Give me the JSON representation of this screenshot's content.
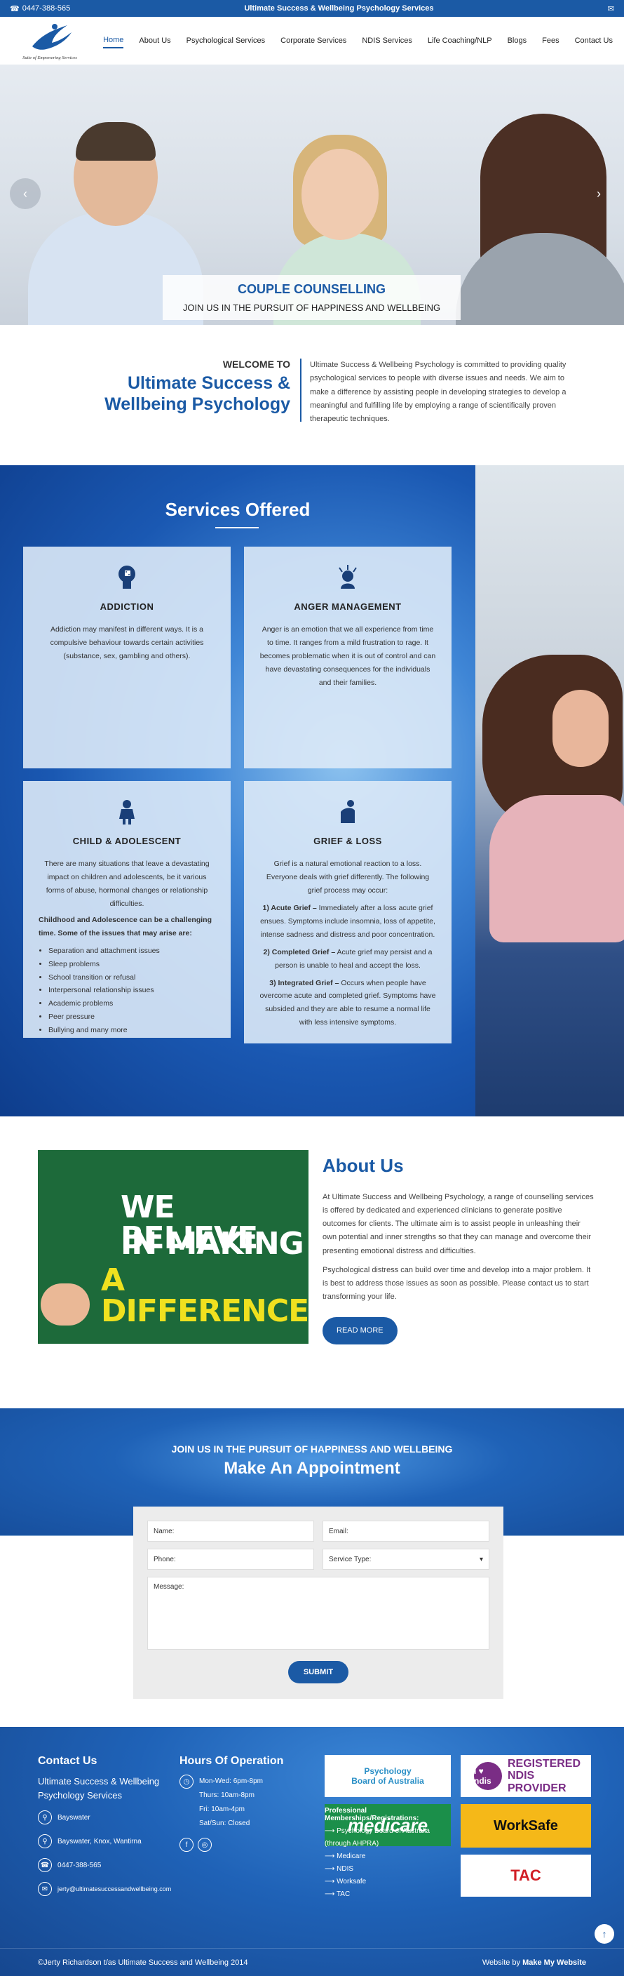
{
  "topbar": {
    "phone": "0447-388-565",
    "center_text": "Ultimate Success & Wellbeing Psychology Services"
  },
  "logo": {
    "tagline": "Suite of Empowering Services"
  },
  "nav": {
    "items": [
      {
        "label": "Home"
      },
      {
        "label": "About Us"
      },
      {
        "label": "Psychological Services"
      },
      {
        "label": "Corporate Services"
      },
      {
        "label": "NDIS Services"
      },
      {
        "label": "Life Coaching/NLP"
      },
      {
        "label": "Blogs"
      },
      {
        "label": "Fees"
      },
      {
        "label": "Contact Us"
      }
    ]
  },
  "hero": {
    "title": "COUPLE COUNSELLING",
    "subtitle": "JOIN US IN THE PURSUIT OF HAPPINESS AND WELLBEING"
  },
  "welcome": {
    "kicker": "WELCOME TO",
    "title": "Ultimate Success & Wellbeing Psychology",
    "body": "Ultimate Success & Wellbeing Psychology is committed to providing quality psychological services to people with diverse issues and needs. We aim to make a difference by assisting people in developing strategies to develop a meaningful and fulfilling life by employing a range of scientifically proven therapeutic techniques."
  },
  "services": {
    "heading": "Services Offered",
    "addiction": {
      "title": "ADDICTION",
      "body": "Addiction may manifest in different ways. It is a compulsive behaviour towards certain activities (substance, sex, gambling and others)."
    },
    "anger": {
      "title": "ANGER MANAGEMENT",
      "body": "Anger is an emotion that we all experience from time to time. It ranges from a mild frustration to rage. It becomes problematic when it is out of control and can have devastating consequences for the individuals and their families."
    },
    "child": {
      "title": "CHILD & ADOLESCENT",
      "body": "There are many situations that leave a devastating impact on children and adolescents, be it various forms of abuse, hormonal changes or relationship difficulties.",
      "lead": "Childhood and Adolescence can be a challenging time. Some of the issues that may arise are:",
      "items": [
        "Separation and attachment issues",
        "Sleep problems",
        "School transition or refusal",
        "Interpersonal relationship issues",
        "Academic problems",
        "Peer pressure",
        "Bullying and many more"
      ]
    },
    "grief": {
      "title": "GRIEF & LOSS",
      "body": "Grief is a natural emotional reaction to a loss. Everyone deals with grief differently. The following grief process may occur:",
      "s1_label": "1) Acute Grief –",
      "s1_text": " Immediately after a loss acute grief ensues. Symptoms include insomnia, loss of appetite, intense sadness and distress and poor concentration.",
      "s2_label": "2) Completed Grief –",
      "s2_text": " Acute grief may persist and a person is unable to heal and accept the loss.",
      "s3_label": "3) Integrated Grief –",
      "s3_text": " Occurs when people have overcome acute and completed grief. Symptoms have subsided and they are able to resume a normal life with less intensive symptoms."
    }
  },
  "about": {
    "image_text": [
      "WE BELIEVE",
      "IN MAKING",
      "A DIFFERENCE"
    ],
    "heading": "About Us",
    "p1": "At Ultimate Success and Wellbeing Psychology, a range of counselling services is offered by dedicated and experienced clinicians to generate positive outcomes for clients. The ultimate aim is to assist people in unleashing their own potential and inner strengths so that they can manage and overcome their presenting emotional distress and difficulties.",
    "p2": "Psychological distress can build over time and develop into a major problem. It is best to address those issues as soon as possible. Please contact us to start transforming your life.",
    "button": "READ MORE"
  },
  "appointment": {
    "kicker": "JOIN US IN THE PURSUIT OF HAPPINESS AND WELLBEING",
    "heading": "Make An Appointment",
    "name": "Name:",
    "email": "Email:",
    "phone": "Phone:",
    "service": "Service Type:",
    "message": "Message:",
    "submit": "SUBMIT"
  },
  "footer": {
    "contact_heading": "Contact Us",
    "org": "Ultimate Success & Wellbeing Psychology Services",
    "loc1": "Bayswater",
    "loc2": "Bayswater, Knox, Wantirna",
    "phone": "0447-388-565",
    "email": "jerty@ultimatesuccessandwellbeing.com",
    "hours_heading": "Hours Of Operation",
    "hours": [
      "Mon-Wed: 6pm-8pm",
      "Thurs: 10am-8pm",
      "Fri: 10am-4pm",
      "Sat/Sun: Closed"
    ],
    "logos": {
      "psych_1": "Psychology",
      "psych_2": "Board of Australia",
      "medicare": "medicare",
      "ndis_ball": "I ♥ ndis",
      "ndis_text": "REGISTERED NDIS PROVIDER",
      "worksafe": "WorkSafe",
      "tac": "TAC"
    },
    "memberships_heading": "Professional Memberships/Registrations:",
    "memberships": [
      "Psychology Board of Australia (through AHPRA)",
      "Medicare",
      "NDIS",
      "Worksafe",
      "TAC"
    ],
    "copyright": "©Jerty Richardson t/as Ultimate Success and Wellbeing 2014",
    "credit_prefix": "Website by",
    "credit_name": "Make My Website"
  }
}
